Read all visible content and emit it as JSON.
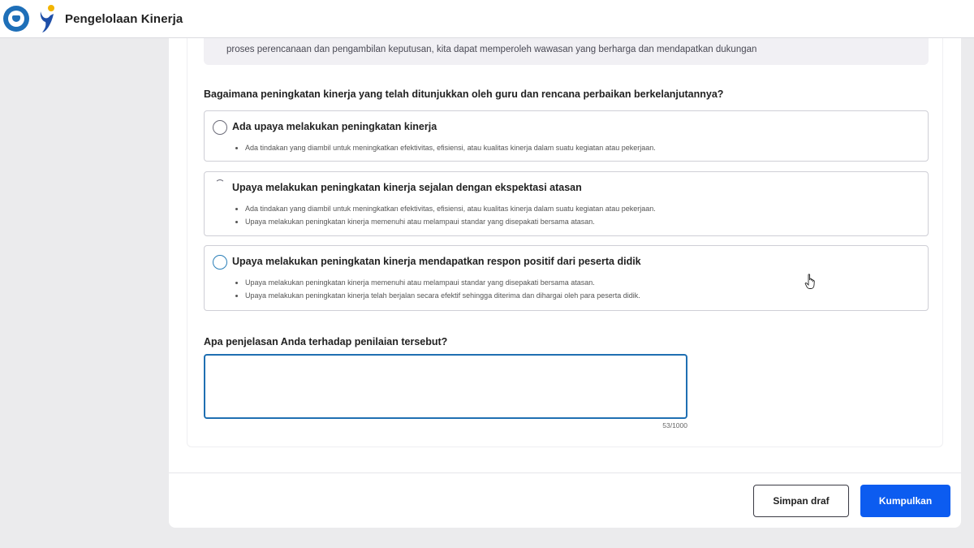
{
  "header": {
    "app_title": "Pengelolaan Kinerja",
    "logo_icons": [
      "kemendikbud-emblem-icon",
      "merdeka-mengajar-logo-icon"
    ]
  },
  "info_box": {
    "text": "proses perencanaan dan pengambilan keputusan, kita dapat memperoleh wawasan yang berharga dan mendapatkan dukungan"
  },
  "question1": {
    "label": "Bagaimana peningkatan kinerja yang telah ditunjukkan oleh guru dan rencana perbaikan berkelanjutannya?",
    "options": [
      {
        "title": "Ada upaya melakukan peningkatan kinerja",
        "bullets": [
          "Ada tindakan yang diambil untuk meningkatkan efektivitas, efisiensi, atau kualitas kinerja dalam suatu kegiatan atau pekerjaan."
        ]
      },
      {
        "title": "Upaya melakukan peningkatan kinerja sejalan dengan ekspektasi atasan",
        "bullets": [
          "Ada tindakan yang diambil untuk meningkatkan efektivitas, efisiensi, atau kualitas kinerja dalam suatu kegiatan atau pekerjaan.",
          "Upaya melakukan peningkatan kinerja memenuhi atau melampaui standar yang disepakati bersama atasan."
        ]
      },
      {
        "title": "Upaya melakukan peningkatan kinerja mendapatkan respon positif dari peserta didik",
        "bullets": [
          "Upaya melakukan peningkatan kinerja memenuhi atau melampaui standar yang disepakati bersama atasan.",
          "Upaya melakukan peningkatan kinerja telah berjalan secara efektif sehingga diterima dan dihargai oleh para peserta didik."
        ]
      }
    ]
  },
  "question2": {
    "label": "Apa penjelasan Anda terhadap penilaian tersebut?",
    "value": "",
    "counter": "53/1000"
  },
  "footer": {
    "draft_label": "Simpan draf",
    "submit_label": "Kumpulkan"
  },
  "colors": {
    "primary": "#0c5cf0",
    "focus_border": "#1f6fb2",
    "page_bg": "#ebebed",
    "info_bg": "#f1f0f4"
  }
}
